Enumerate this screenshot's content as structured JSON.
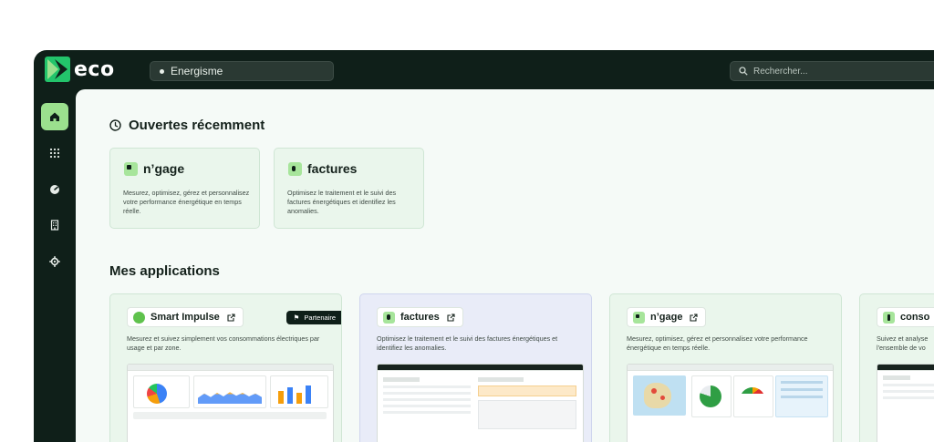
{
  "app": {
    "name": "eco"
  },
  "header": {
    "workspace": "Energisme",
    "search_placeholder": "Rechercher..."
  },
  "sidebar": {
    "items": [
      {
        "icon": "home-icon",
        "active": true
      },
      {
        "icon": "apps-grid-icon",
        "active": false
      },
      {
        "icon": "gauge-icon",
        "active": false
      },
      {
        "icon": "building-icon",
        "active": false
      },
      {
        "icon": "gear-icon",
        "active": false
      }
    ]
  },
  "recent": {
    "title": "Ouvertes récemment",
    "cards": [
      {
        "name": "n’gage",
        "description": "Mesurez, optimisez, gérez et personnalisez votre performance énergétique en temps réelle."
      },
      {
        "name": "factures",
        "description": "Optimisez le traitement et le suivi des factures énergétiques et identifiez les anomalies."
      }
    ]
  },
  "applications": {
    "title": "Mes applications",
    "cards": [
      {
        "name": "Smart Impulse",
        "badge": "Partenaire",
        "description": "Mesurez et suivez simplement vos consommations électriques par usage et par zone."
      },
      {
        "name": "factures",
        "description": "Optimisez le traitement et le suivi des factures énergétiques et identifiez les anomalies."
      },
      {
        "name": "n’gage",
        "description": "Mesurez, optimisez, gérez et personnalisez votre performance énergétique en temps réelle."
      },
      {
        "name": "conso",
        "description": "Suivez et analyse l'ensemble de vo"
      }
    ]
  },
  "colors": {
    "dark": "#0f1f19",
    "accent": "#9be08e",
    "card": "#eaf6ec"
  }
}
